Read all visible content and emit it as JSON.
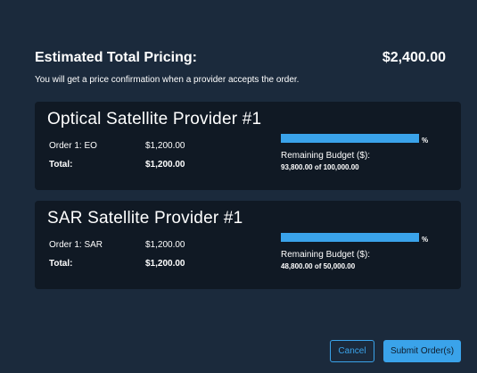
{
  "summary": {
    "title": "Estimated Total Pricing:",
    "total": "$2,400.00",
    "note": "You will get a price confirmation when a provider accepts the order."
  },
  "providers": [
    {
      "name": "Optical Satellite Provider #1",
      "order_label": "Order 1: EO",
      "order_value": "$1,200.00",
      "total_label": "Total:",
      "total_value": "$1,200.00",
      "budget_used_fraction": 1.0,
      "pct_symbol": "%",
      "budget_label": "Remaining Budget ($):",
      "budget_value": "93,800.00 of 100,000.00"
    },
    {
      "name": "SAR Satellite Provider #1",
      "order_label": "Order 1: SAR",
      "order_value": "$1,200.00",
      "total_label": "Total:",
      "total_value": "$1,200.00",
      "budget_used_fraction": 1.0,
      "pct_symbol": "%",
      "budget_label": "Remaining Budget ($):",
      "budget_value": "48,800.00 of 50,000.00"
    }
  ],
  "actions": {
    "cancel": "Cancel",
    "submit": "Submit Order(s)"
  },
  "colors": {
    "background": "#1b2a3c",
    "card": "#101924",
    "accent": "#3aa3ea"
  }
}
